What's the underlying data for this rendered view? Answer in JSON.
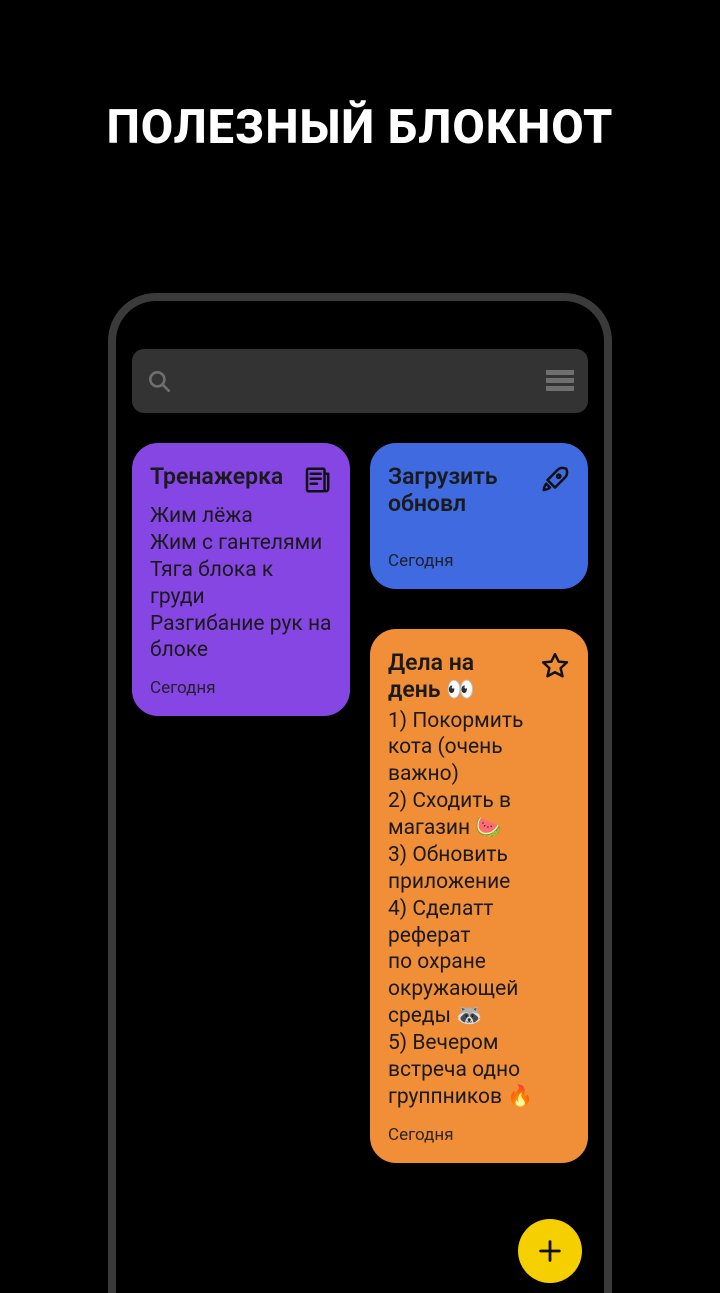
{
  "headline": "ПОЛЕЗНЫЙ БЛОКНОТ",
  "search": {
    "placeholder": ""
  },
  "cards": {
    "gym": {
      "title": "Тренажерка",
      "body": "Жим лёжа\nЖим с гантелями\nТяга блока к груди\nРазгибание рук на блоке",
      "date": "Сегодня"
    },
    "update": {
      "title": "Загрузить обновл",
      "body": "",
      "date": "Сегодня"
    },
    "todo": {
      "title": "Дела на день 👀",
      "body": "1) Покормить кота (очень важно)\n2) Сходить в магазин 🍉\n3) Обновить приложение\n4) Сделатт реферат\nпо охране окружающей среды 🦝\n5) Вечером встреча одно группников 🔥",
      "date": "Сегодня"
    }
  }
}
